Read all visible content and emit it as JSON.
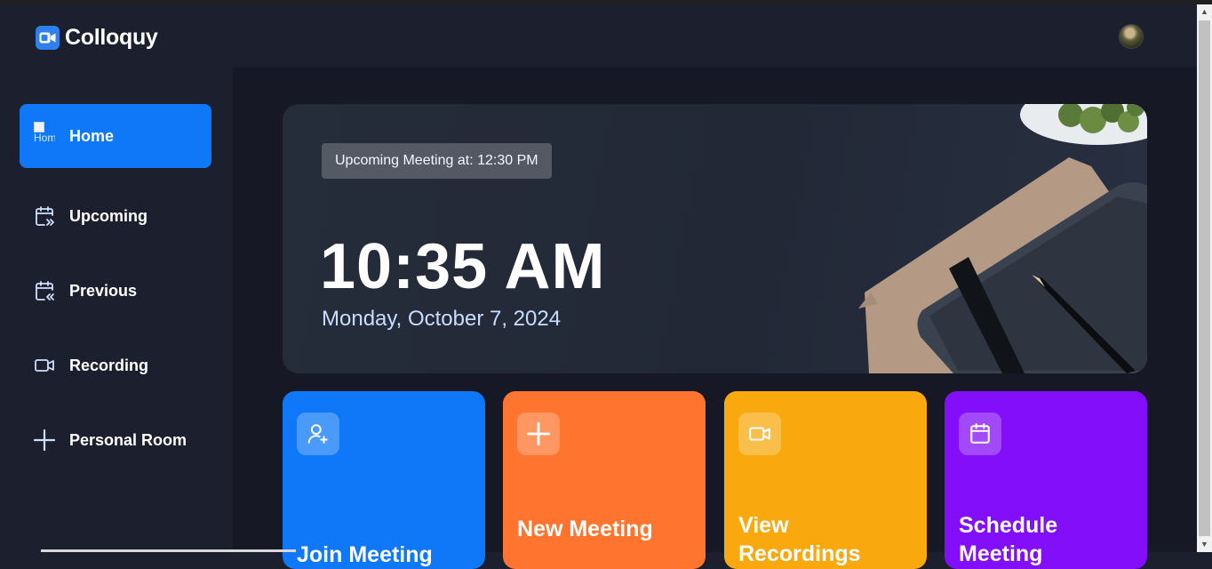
{
  "app": {
    "name": "Colloquy"
  },
  "sidebar": {
    "items": [
      {
        "label": "Home",
        "icon": "home-icon",
        "active": true,
        "icon_alt": "Home"
      },
      {
        "label": "Upcoming",
        "icon": "calendar-upcoming-icon"
      },
      {
        "label": "Previous",
        "icon": "calendar-previous-icon"
      },
      {
        "label": "Recording",
        "icon": "video-icon"
      },
      {
        "label": "Personal Room",
        "icon": "plus-icon"
      }
    ]
  },
  "hero": {
    "badge": "Upcoming Meeting at: 12:30 PM",
    "time": "10:35 AM",
    "date": "Monday, October 7, 2024"
  },
  "cards": [
    {
      "title": "Join Meeting",
      "icon": "add-user-icon",
      "color": "#0e78f9"
    },
    {
      "title": "New Meeting",
      "icon": "plus-icon",
      "color": "#ff742e"
    },
    {
      "title": "View Recordings",
      "icon": "video-icon",
      "color": "#f9a90e"
    },
    {
      "title": "Schedule Meeting",
      "icon": "calendar-icon",
      "color": "#830ef9"
    }
  ],
  "colors": {
    "background": "#1c1f2e",
    "main_background": "#161925",
    "accent": "#0e78f9"
  }
}
